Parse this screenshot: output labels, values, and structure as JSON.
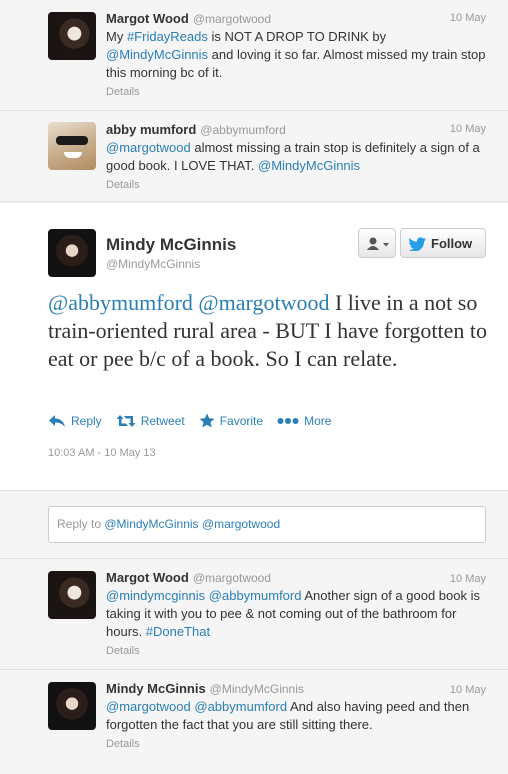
{
  "tweets_top": [
    {
      "name": "Margot Wood",
      "handle": "@margotwood",
      "time": "10 May",
      "text_parts": [
        "My ",
        "#FridayReads",
        " is NOT A DROP TO DRINK by ",
        "@MindyMcGinnis",
        " and loving it so far. Almost missed my train stop this morning bc of it."
      ],
      "details": "Details"
    },
    {
      "name": "abby mumford",
      "handle": "@abbymumford",
      "time": "10 May",
      "text_parts": [
        "@margotwood",
        " almost missing a train stop is definitely a sign of a good book. I LOVE THAT. ",
        "@MindyMcGinnis"
      ],
      "details": "Details"
    }
  ],
  "expanded": {
    "name": "Mindy McGinnis",
    "handle": "@MindyMcGinnis",
    "follow_label": "Follow",
    "text_parts": [
      "@abbymumford",
      " ",
      "@margotwood",
      " I live in a not so train-oriented rural area - BUT I have forgotten to eat or pee b/c of a book. So I can relate."
    ],
    "actions": {
      "reply": "Reply",
      "retweet": "Retweet",
      "favorite": "Favorite",
      "more": "More"
    },
    "timestamp": "10:03 AM - 10 May 13"
  },
  "reply_box": {
    "prefix": "Reply to ",
    "mentions": "@MindyMcGinnis @margotwood"
  },
  "tweets_bottom": [
    {
      "name": "Margot Wood",
      "handle": "@margotwood",
      "time": "10 May",
      "text_parts": [
        "@mindymcginnis",
        " ",
        "@abbymumford",
        " Another sign of a good book is taking it with you to pee & not coming out of the bathroom for hours. ",
        "#DoneThat"
      ],
      "details": "Details"
    },
    {
      "name": "Mindy McGinnis",
      "handle": "@MindyMcGinnis",
      "time": "10 May",
      "text_parts": [
        "@margotwood",
        " ",
        "@abbymumford",
        " And also having peed and then forgotten the fact that you are still sitting there."
      ],
      "details": "Details"
    }
  ],
  "colors": {
    "link": "#2a7fb5",
    "muted": "#999999",
    "background": "#f5f5f5"
  }
}
